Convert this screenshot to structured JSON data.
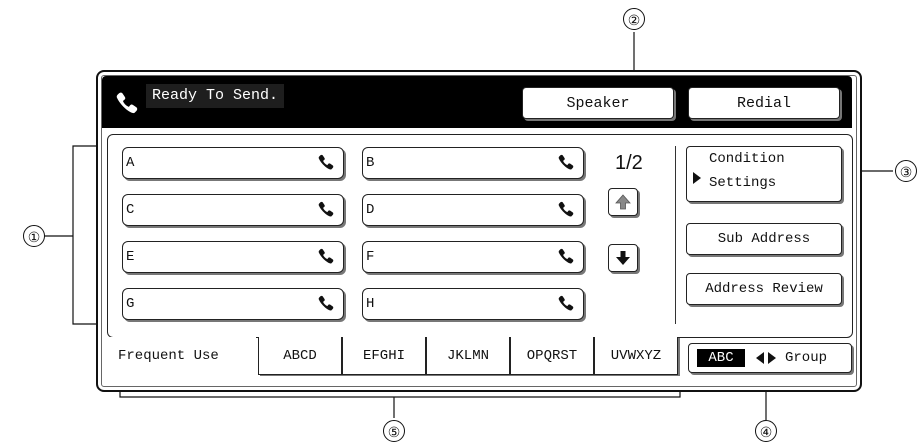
{
  "status": {
    "text": "Ready To Send.",
    "icon": "phone-icon"
  },
  "top_buttons": {
    "speaker": "Speaker",
    "redial": "Redial"
  },
  "destinations": [
    {
      "label": "A"
    },
    {
      "label": "B"
    },
    {
      "label": "C"
    },
    {
      "label": "D"
    },
    {
      "label": "E"
    },
    {
      "label": "F"
    },
    {
      "label": "G"
    },
    {
      "label": "H"
    }
  ],
  "pagination": {
    "indicator": "1/2"
  },
  "side_buttons": {
    "condition_line1": "Condition",
    "condition_line2": "Settings",
    "sub_address": "Sub Address",
    "address_review": "Address Review"
  },
  "tabs": [
    "Frequent Use",
    "ABCD",
    "EFGHI",
    "JKLMN",
    "OPQRST",
    "UVWXYZ"
  ],
  "abc_toggle": {
    "abc": "ABC",
    "group": "Group"
  },
  "callouts": {
    "c1": "①",
    "c2": "②",
    "c3": "③",
    "c4": "④",
    "c5": "⑤"
  }
}
